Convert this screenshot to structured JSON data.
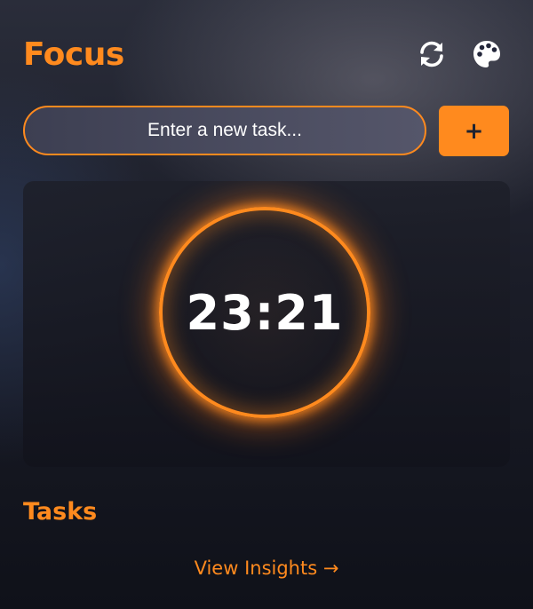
{
  "app": {
    "title": "Focus"
  },
  "header": {
    "actions": [
      {
        "icon": "refresh-icon"
      },
      {
        "icon": "palette-icon"
      }
    ]
  },
  "task_input": {
    "placeholder": "Enter a new task...",
    "value": ""
  },
  "add_button": {
    "label": "+"
  },
  "timer": {
    "display": "23:21"
  },
  "tasks_section": {
    "title": "Tasks",
    "items": []
  },
  "footer": {
    "insights_link": "View Insights →"
  },
  "colors": {
    "accent": "#ff8a1e",
    "background_dark": "#0f1119",
    "text": "#ffffff"
  }
}
